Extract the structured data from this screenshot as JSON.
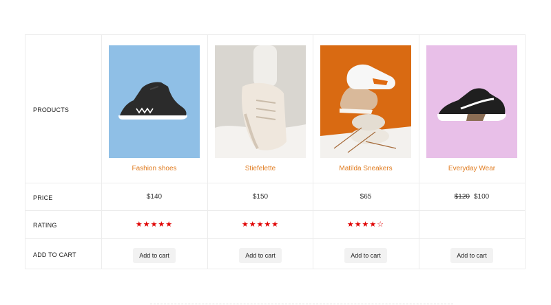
{
  "labels": {
    "products": "PRODUCTS",
    "price": "PRICE",
    "rating": "RATING",
    "add_to_cart": "ADD TO CART"
  },
  "products": [
    {
      "name": "Fashion shoes",
      "price": "$140",
      "old_price": "",
      "rating": 5,
      "stars_full": "★★★★★",
      "stars_empty": "",
      "button": "Add to cart",
      "bg": "#8fbfe6"
    },
    {
      "name": "Stiefelette",
      "price": "$150",
      "old_price": "",
      "rating": 5,
      "stars_full": "★★★★★",
      "stars_empty": "",
      "button": "Add to cart",
      "bg": "#e6e3de"
    },
    {
      "name": "Matilda Sneakers",
      "price": "$65",
      "old_price": "",
      "rating": 4,
      "stars_full": "★★★★",
      "stars_empty": "☆",
      "button": "Add to cart",
      "bg": "#d96a12"
    },
    {
      "name": "Everyday Wear",
      "price": "$100",
      "old_price": "$120",
      "rating": 0,
      "stars_full": "",
      "stars_empty": "",
      "button": "Add to cart",
      "bg": "#e8bfe8"
    }
  ],
  "colors": {
    "accent": "#e07b1f",
    "star": "#e00000"
  }
}
